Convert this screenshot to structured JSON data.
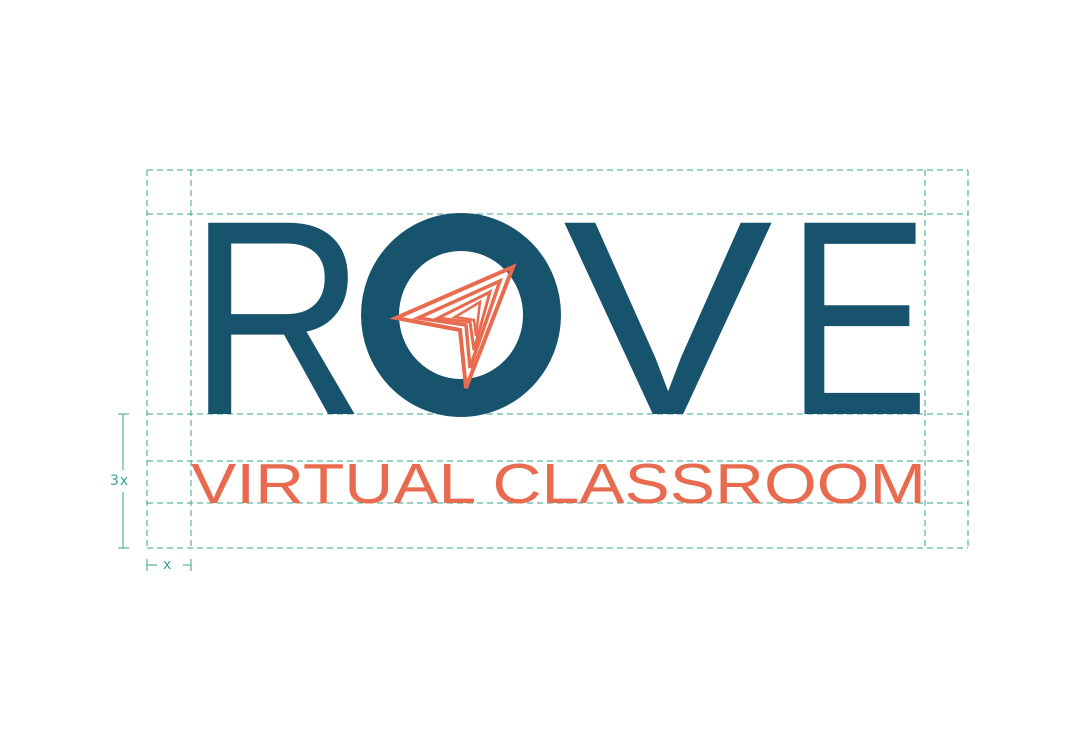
{
  "logo": {
    "wordmark_letters": [
      "R",
      "O",
      "V",
      "E"
    ],
    "wordmark": "ROVE",
    "tagline": "VIRTUAL CLASSROOM",
    "icon": "paper-plane-arrow-icon"
  },
  "guides": {
    "height_label": "3x",
    "width_label": "x"
  },
  "colors": {
    "wordmark": "#18536d",
    "tagline": "#e86a4f",
    "icon": "#e86a4f",
    "guide": "#39a38f",
    "background": "#ffffff"
  }
}
